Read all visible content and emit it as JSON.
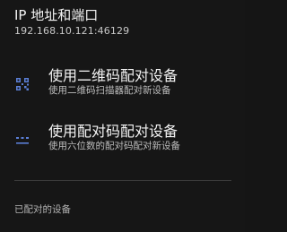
{
  "ip_section": {
    "title": "IP 地址和端口",
    "value": "192.168.10.121:46129"
  },
  "options": [
    {
      "icon": "qr-code-scanner-icon",
      "title": "使用二维码配对设备",
      "subtitle": "使用二维码扫描器配对新设备"
    },
    {
      "icon": "dialpad-icon",
      "title": "使用配对码配对设备",
      "subtitle": "使用六位数的配对码配对新设备"
    }
  ],
  "paired_devices": {
    "header": "已配对的设备"
  },
  "colors": {
    "background": "#161616",
    "accent": "#5b7fd6",
    "divider": "#3a3a3a"
  }
}
